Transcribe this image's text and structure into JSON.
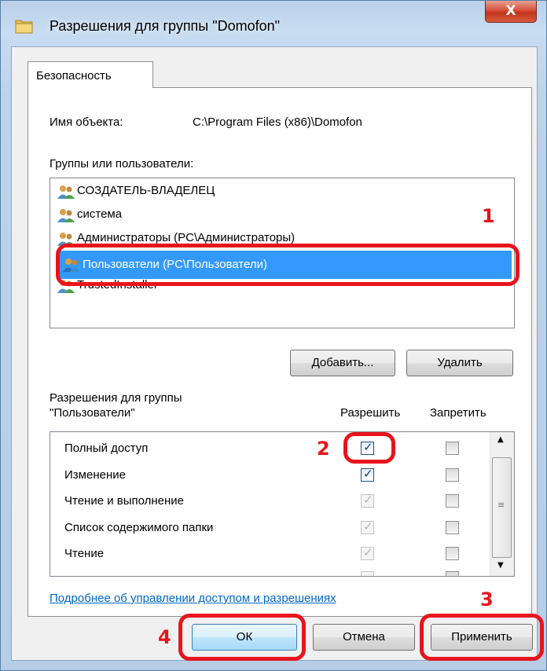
{
  "window": {
    "title": "Разрешения для группы \"Domofon\"",
    "close_label": "X"
  },
  "tab": {
    "label": "Безопасность"
  },
  "object": {
    "label": "Имя объекта:",
    "value": "C:\\Program Files (x86)\\Domofon"
  },
  "groups": {
    "label": "Группы или пользователи:",
    "items": [
      {
        "label": "СОЗДАТЕЛЬ-ВЛАДЕЛЕЦ",
        "selected": false
      },
      {
        "label": "система",
        "selected": false
      },
      {
        "label": "Администраторы (PC\\Администраторы)",
        "selected": false
      },
      {
        "label": "Пользователи (PC\\Пользователи)",
        "selected": true
      },
      {
        "label": "TrustedInstaller",
        "selected": false
      }
    ]
  },
  "buttons": {
    "add": "Добавить...",
    "remove": "Удалить",
    "ok": "ОК",
    "cancel": "Отмена",
    "apply": "Применить"
  },
  "permissions": {
    "header_line1": "Разрешения для группы",
    "header_line2": "\"Пользователи\"",
    "col_allow": "Разрешить",
    "col_deny": "Запретить",
    "rows": [
      {
        "label": "Полный доступ",
        "allow": "checked",
        "deny": "unchecked"
      },
      {
        "label": "Изменение",
        "allow": "checked",
        "deny": "unchecked"
      },
      {
        "label": "Чтение и выполнение",
        "allow": "checked-disabled",
        "deny": "unchecked"
      },
      {
        "label": "Список содержимого папки",
        "allow": "checked-disabled",
        "deny": "unchecked"
      },
      {
        "label": "Чтение",
        "allow": "checked-disabled",
        "deny": "unchecked"
      }
    ]
  },
  "link": {
    "label": "Подробнее об управлении доступом и разрешениях"
  },
  "annotations": {
    "color": "#e8141c",
    "step1": "1",
    "step2": "2",
    "step3": "3",
    "step4": "4"
  },
  "colors": {
    "selection": "#3399ff",
    "link": "#0066cc"
  }
}
